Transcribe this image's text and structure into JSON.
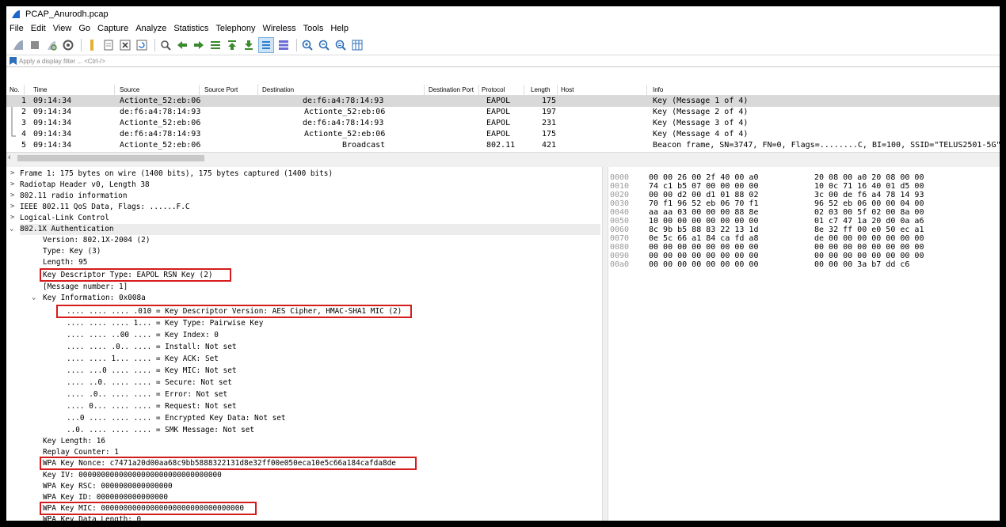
{
  "window": {
    "title": "PCAP_Anurodh.pcap"
  },
  "menu": [
    "File",
    "Edit",
    "View",
    "Go",
    "Capture",
    "Analyze",
    "Statistics",
    "Telephony",
    "Wireless",
    "Tools",
    "Help"
  ],
  "filter": {
    "placeholder": "Apply a display filter ... <Ctrl-/>"
  },
  "columns": {
    "no": "No.",
    "time": "Time",
    "source": "Source",
    "source_port": "Source Port",
    "destination": "Destination",
    "destination_port": "Destination Port",
    "protocol": "Protocol",
    "length": "Length",
    "host": "Host",
    "info": "Info"
  },
  "packets": [
    {
      "no": "1",
      "time": "09:14:34",
      "source": "Actionte_52:eb:06",
      "destination": "de:f6:a4:78:14:93",
      "protocol": "EAPOL",
      "length": "175",
      "info": "Key (Message 1 of 4)"
    },
    {
      "no": "2",
      "time": "09:14:34",
      "source": "de:f6:a4:78:14:93",
      "destination": "Actionte_52:eb:06",
      "protocol": "EAPOL",
      "length": "197",
      "info": "Key (Message 2 of 4)"
    },
    {
      "no": "3",
      "time": "09:14:34",
      "source": "Actionte_52:eb:06",
      "destination": "de:f6:a4:78:14:93",
      "protocol": "EAPOL",
      "length": "231",
      "info": "Key (Message 3 of 4)"
    },
    {
      "no": "4",
      "time": "09:14:34",
      "source": "de:f6:a4:78:14:93",
      "destination": "Actionte_52:eb:06",
      "protocol": "EAPOL",
      "length": "175",
      "info": "Key (Message 4 of 4)"
    },
    {
      "no": "5",
      "time": "09:14:34",
      "source": "Actionte_52:eb:06",
      "destination": "Broadcast",
      "protocol": "802.11",
      "length": "421",
      "info": "Beacon frame, SN=3747, FN=0, Flags=........C, BI=100, SSID=\"TELUS2501-5G\""
    }
  ],
  "details": [
    "Frame 1: 175 bytes on wire (1400 bits), 175 bytes captured (1400 bits)",
    "Radiotap Header v0, Length 38",
    "802.11 radio information",
    "IEEE 802.11 QoS Data, Flags: ......F.C",
    "Logical-Link Control",
    "802.1X Authentication",
    "Version: 802.1X-2004 (2)",
    "Type: Key (3)",
    "Length: 95",
    "Key Descriptor Type: EAPOL RSN Key (2)",
    "[Message number: 1]",
    "Key Information: 0x008a",
    ".... .... .... .010 = Key Descriptor Version: AES Cipher, HMAC-SHA1 MIC (2)",
    ".... .... .... 1... = Key Type: Pairwise Key",
    ".... .... ..00 .... = Key Index: 0",
    ".... .... .0.. .... = Install: Not set",
    ".... .... 1... .... = Key ACK: Set",
    ".... ...0 .... .... = Key MIC: Not set",
    ".... ..0. .... .... = Secure: Not set",
    ".... .0.. .... .... = Error: Not set",
    ".... 0... .... .... = Request: Not set",
    "...0 .... .... .... = Encrypted Key Data: Not set",
    "..0. .... .... .... = SMK Message: Not set",
    "Key Length: 16",
    "Replay Counter: 1",
    "WPA Key Nonce: c7471a20d00aa68c9bb5888322131d8e32ff00e050eca10e5c66a184cafda8de",
    "Key IV: 00000000000000000000000000000000",
    "WPA Key RSC: 0000000000000000",
    "WPA Key ID: 0000000000000000",
    "WPA Key MIC: 00000000000000000000000000000000",
    "WPA Key Data Length: 0"
  ],
  "hex": [
    {
      "off": "0000",
      "b1": "00 00 26 00 2f 40 00 a0",
      "b2": "20 08 00 a0 20 08 00 00"
    },
    {
      "off": "0010",
      "b1": "74 c1 b5 07 00 00 00 00",
      "b2": "10 0c 71 16 40 01 d5 00"
    },
    {
      "off": "0020",
      "b1": "00 00 d2 00 d1 01 88 02",
      "b2": "3c 00 de f6 a4 78 14 93"
    },
    {
      "off": "0030",
      "b1": "70 f1 96 52 eb 06 70 f1",
      "b2": "96 52 eb 06 00 00 04 00"
    },
    {
      "off": "0040",
      "b1": "aa aa 03 00 00 00 88 8e",
      "b2": "02 03 00 5f 02 00 8a 00"
    },
    {
      "off": "0050",
      "b1": "10 00 00 00 00 00 00 00",
      "b2": "01 c7 47 1a 20 d0 0a a6"
    },
    {
      "off": "0060",
      "b1": "8c 9b b5 88 83 22 13 1d",
      "b2": "8e 32 ff 00 e0 50 ec a1"
    },
    {
      "off": "0070",
      "b1": "0e 5c 66 a1 84 ca fd a8",
      "b2": "de 00 00 00 00 00 00 00"
    },
    {
      "off": "0080",
      "b1": "00 00 00 00 00 00 00 00",
      "b2": "00 00 00 00 00 00 00 00"
    },
    {
      "off": "0090",
      "b1": "00 00 00 00 00 00 00 00",
      "b2": "00 00 00 00 00 00 00 00"
    },
    {
      "off": "00a0",
      "b1": "00 00 00 00 00 00 00 00",
      "b2": "00 00 00 3a b7 dd c6"
    }
  ],
  "colors": {
    "selected_row": "#d9d9d9",
    "highlight_box": "#d51c1c",
    "accent": "#1e66c9"
  }
}
